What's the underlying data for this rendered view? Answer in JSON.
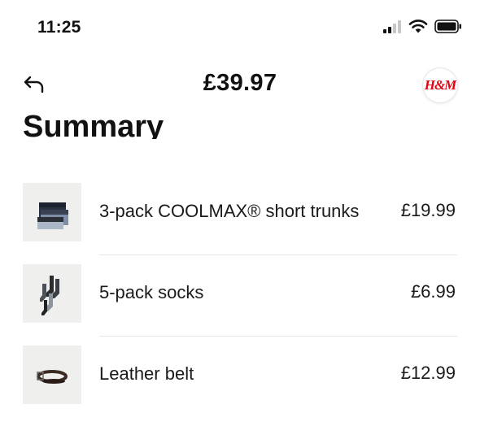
{
  "status_bar": {
    "time": "11:25"
  },
  "header": {
    "total_price": "£39.97",
    "brand_logo_text": "H&M"
  },
  "summary": {
    "title": "Summary",
    "items": [
      {
        "name": "3-pack COOLMAX® short trunks",
        "price": "£19.99",
        "thumbnail": "trunks-image"
      },
      {
        "name": "5-pack socks",
        "price": "£6.99",
        "thumbnail": "socks-image"
      },
      {
        "name": "Leather belt",
        "price": "£12.99",
        "thumbnail": "belt-image"
      }
    ]
  },
  "colors": {
    "brand_red": "#e50010",
    "text": "#111111",
    "divider": "#e8e8e8",
    "thumb_bg": "#efefed"
  },
  "icons": [
    "signal-icon",
    "wifi-icon",
    "battery-icon",
    "back-arrow-icon"
  ]
}
